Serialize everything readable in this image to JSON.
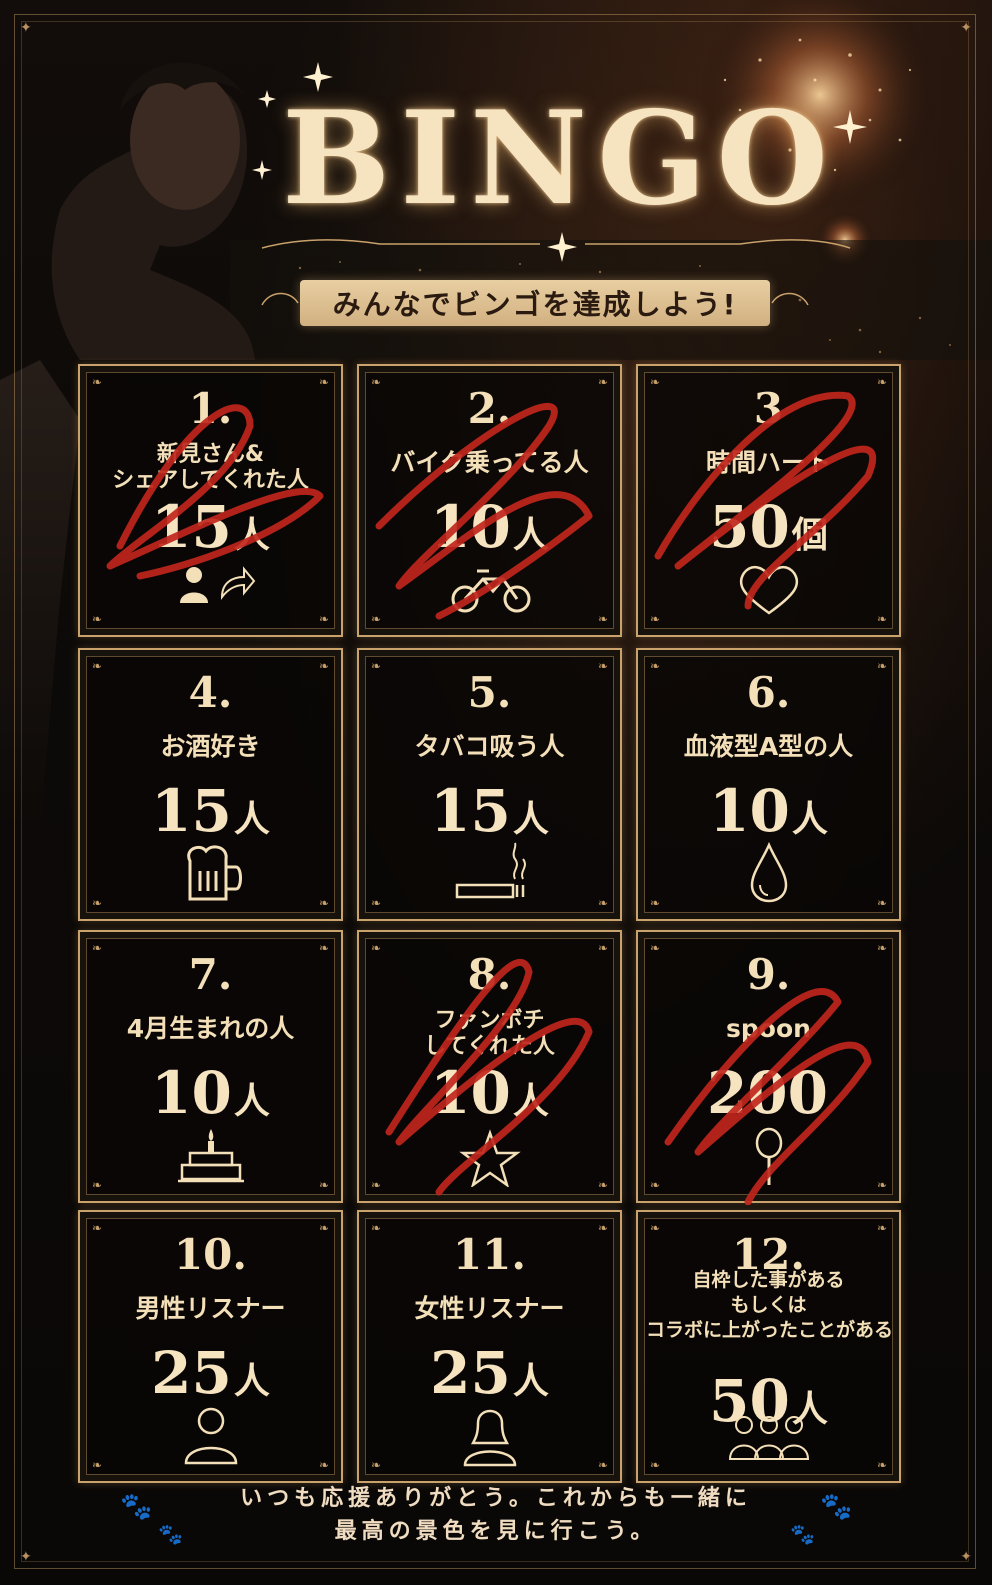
{
  "header": {
    "title": "BINGO",
    "subtitle": "みんなでビンゴを達成しよう!"
  },
  "cells": [
    {
      "num": "1.",
      "label_line1": "新見さん&",
      "label_line2": "シェアしてくれた人",
      "count": "15",
      "unit": "人",
      "icon": "share-user-icon",
      "crossed": true
    },
    {
      "num": "2.",
      "label_line1": "バイク乗ってる人",
      "count": "10",
      "unit": "人",
      "icon": "motorbike-icon",
      "crossed": true
    },
    {
      "num": "3",
      "label_line1": "時間ハート",
      "count": "50",
      "unit": "個",
      "icon": "heart-icon",
      "crossed": true
    },
    {
      "num": "4.",
      "label_line1": "お酒好き",
      "count": "15",
      "unit": "人",
      "icon": "beer-mug-icon",
      "crossed": false
    },
    {
      "num": "5.",
      "label_line1": "タバコ吸う人",
      "count": "15",
      "unit": "人",
      "icon": "cigarette-icon",
      "crossed": false
    },
    {
      "num": "6.",
      "label_line1": "血液型A型の人",
      "count": "10",
      "unit": "人",
      "icon": "blood-drop-icon",
      "crossed": false
    },
    {
      "num": "7.",
      "label_line1": "4月生まれの人",
      "count": "10",
      "unit": "人",
      "icon": "birthday-cake-icon",
      "crossed": false
    },
    {
      "num": "8.",
      "label_line1": "ファンボチ",
      "label_line2": "してくれた人",
      "count": "10",
      "unit": "人",
      "icon": "star-icon",
      "crossed": true
    },
    {
      "num": "9.",
      "label_line1": "spoon",
      "count": "200",
      "unit": "",
      "icon": "spoon-icon",
      "crossed": true
    },
    {
      "num": "10.",
      "label_line1": "男性リスナー",
      "count": "25",
      "unit": "人",
      "icon": "male-user-icon",
      "crossed": false
    },
    {
      "num": "11.",
      "label_line1": "女性リスナー",
      "count": "25",
      "unit": "人",
      "icon": "female-user-icon",
      "crossed": false
    },
    {
      "num": "12.",
      "label_line1": "自枠した事がある",
      "label_line2": "もしくは",
      "label_line3": "コラボに上がったことがある",
      "count": "50",
      "unit": "人",
      "icon": "group-users-icon",
      "crossed": false
    }
  ],
  "footer": {
    "line1": "いつも応援ありがとう。これからも一緒に",
    "line2": "最高の景色を見に行こう。"
  },
  "colors": {
    "background": "#0a0807",
    "gold": "#caa36c",
    "text": "#f3dfb8",
    "banner": "#e8cfa2",
    "scribble": "#c0261c"
  }
}
